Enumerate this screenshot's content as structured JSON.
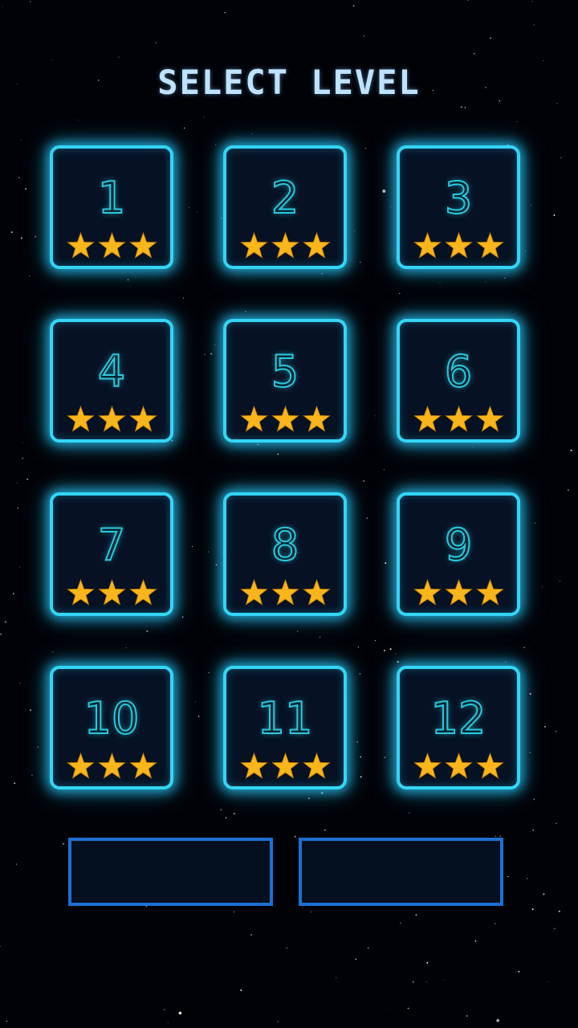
{
  "title": "SELECT LEVEL",
  "levels": [
    {
      "number": "1",
      "stars": 3
    },
    {
      "number": "2",
      "stars": 3
    },
    {
      "number": "3",
      "stars": 3
    },
    {
      "number": "4",
      "stars": 3
    },
    {
      "number": "5",
      "stars": 3
    },
    {
      "number": "6",
      "stars": 3
    },
    {
      "number": "7",
      "stars": 3
    },
    {
      "number": "8",
      "stars": 3
    },
    {
      "number": "9",
      "stars": 3
    },
    {
      "number": "10",
      "stars": 3
    },
    {
      "number": "11",
      "stars": 3
    },
    {
      "number": "12",
      "stars": 3
    }
  ],
  "stars_max": 3,
  "colors": {
    "background": "#010206",
    "tile_border": "#34d5f5",
    "tile_fill": "#061224",
    "number_outline": "#29c9de",
    "star": "#f8b51c",
    "button_border": "#1f6fd4",
    "title": "#bfe3ff"
  },
  "buttons": {
    "left_icon": "empty",
    "right_icon": "empty"
  }
}
